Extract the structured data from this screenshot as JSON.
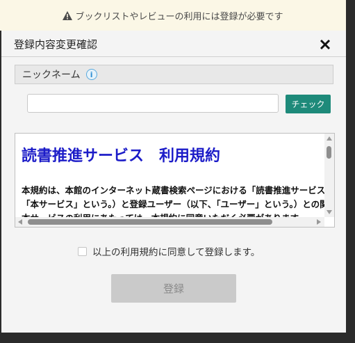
{
  "notice": {
    "icon": "warning-icon",
    "text": "ブックリストやレビューの利用には登録が必要です"
  },
  "dialog": {
    "title": "登録内容変更確認",
    "close_icon": "close-icon"
  },
  "nickname": {
    "label": "ニックネーム",
    "info_icon": "info-icon",
    "info_glyph": "i",
    "value": "",
    "check_button_label": "チェック"
  },
  "terms": {
    "title": "読書推進サービス　利用規約",
    "body_line_1": "本規約は、本館のインターネット蔵書検索ページにおける「読書推進サービス」（以下、",
    "body_line_2": "「本サービス」という。）と登録ユーザー（以下、「ユーザー」という。）との関係を定めるものです。",
    "body_line_3": "本サービスの利用にあたっては、本規約に同意いただく必要があります。"
  },
  "agreement": {
    "checked": false,
    "label": "以上の利用規約に同意して登録します。"
  },
  "register_button_label": "登録",
  "colors": {
    "notice_bg": "#fbf7e6",
    "check_button": "#1e8a7a",
    "terms_title": "#1c1cc8",
    "register_disabled": "#cacaca"
  }
}
